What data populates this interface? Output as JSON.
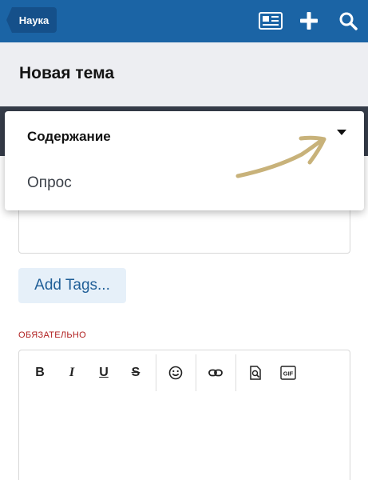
{
  "header": {
    "back_label": "Наука",
    "icons": [
      "news-icon",
      "plus-icon",
      "search-icon"
    ]
  },
  "page": {
    "title": "Новая тема"
  },
  "dropdown": {
    "options": [
      {
        "label": "Содержание",
        "selected": true
      },
      {
        "label": "Опрос",
        "selected": false
      }
    ]
  },
  "form": {
    "tags_button": "Add Tags...",
    "required_label": "ОБЯЗАТЕЛЬНО"
  },
  "editor": {
    "toolbar": [
      {
        "name": "bold-icon",
        "glyph": "B"
      },
      {
        "name": "italic-icon",
        "glyph": "I"
      },
      {
        "name": "underline-icon",
        "glyph": "U"
      },
      {
        "name": "strikethrough-icon",
        "glyph": "S"
      },
      {
        "name": "emoji-icon"
      },
      {
        "name": "link-icon"
      },
      {
        "name": "preview-icon"
      },
      {
        "name": "gif-icon",
        "glyph": "GIF"
      }
    ]
  },
  "colors": {
    "header_bg": "#1b64a5",
    "back_button_bg": "#15508a",
    "tags_button_bg": "#e6f0f9",
    "tags_button_text": "#1f5e97",
    "required_text": "#b02020",
    "arrow_annotation": "#c8b27a"
  }
}
